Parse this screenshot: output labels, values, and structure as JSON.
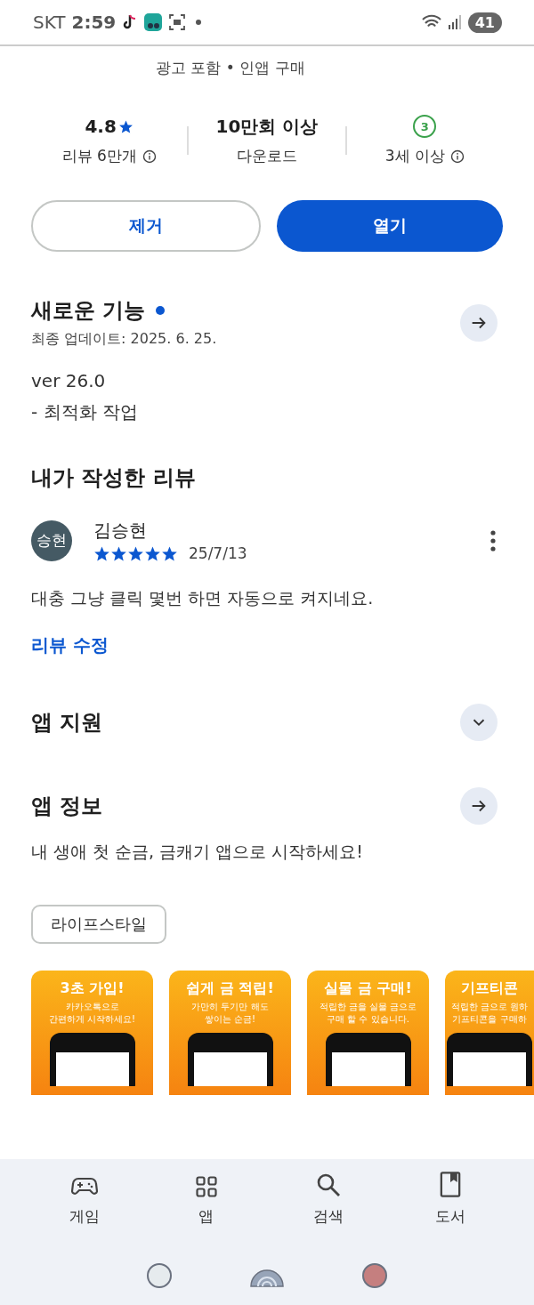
{
  "status_bar": {
    "carrier": "SKT",
    "time": "2:59",
    "battery": "41"
  },
  "app": {
    "tags": "광고 포함 • 인앱 구매"
  },
  "stats": [
    {
      "kind": "rating",
      "value": "4.8",
      "label": "리뷰 6만개",
      "info": true
    },
    {
      "kind": "text",
      "value": "10만회 이상",
      "label": "다운로드",
      "info": false
    },
    {
      "kind": "age",
      "value": "3",
      "label": "3세 이상",
      "info": true
    }
  ],
  "buttons": [
    {
      "label": "제거",
      "kind": "outline"
    },
    {
      "label": "열기",
      "kind": "filled"
    }
  ],
  "whats_new": {
    "title": "새로운 기능",
    "new_dot": true,
    "updated": "최종 업데이트: 2025. 6. 25.",
    "lines": [
      "ver 26.0",
      "- 최적화 작업"
    ]
  },
  "my_review": {
    "title": "내가 작성한 리뷰",
    "avatar": "승현",
    "author": "김승현",
    "stars": 5,
    "date": "25/7/13",
    "text": "대충 그냥 클릭 몇번 하면 자동으로 켜지네요.",
    "edit_link": "리뷰 수정"
  },
  "sections": [
    {
      "title": "앱 지원",
      "kind": "expand"
    },
    {
      "title": "앱 정보",
      "kind": "arrow",
      "description": "내 생애 첫 순금, 금캐기 앱으로 시작하세요!"
    }
  ],
  "category_chip": "라이프스타일",
  "screenshots": [
    {
      "headline": "3초 가입!",
      "caption": [
        "카카오톡으로",
        "간편하게 시작하세요!"
      ]
    },
    {
      "headline": "쉽게 금 적립!",
      "caption": [
        "가만히 두기만 해도",
        "쌓이는 순금!"
      ]
    },
    {
      "headline": "실물 금 구매!",
      "caption": [
        "적립한 금을 실물 금으로",
        "구매 할 수 있습니다."
      ]
    },
    {
      "headline": "기프티콘",
      "caption": [
        "적립한 금으로 원하",
        "기프티콘을 구매하"
      ]
    }
  ],
  "bottom_nav": [
    {
      "label": "게임",
      "kind": "game"
    },
    {
      "label": "앱",
      "kind": "apps"
    },
    {
      "label": "검색",
      "kind": "search"
    },
    {
      "label": "도서",
      "kind": "book"
    }
  ]
}
